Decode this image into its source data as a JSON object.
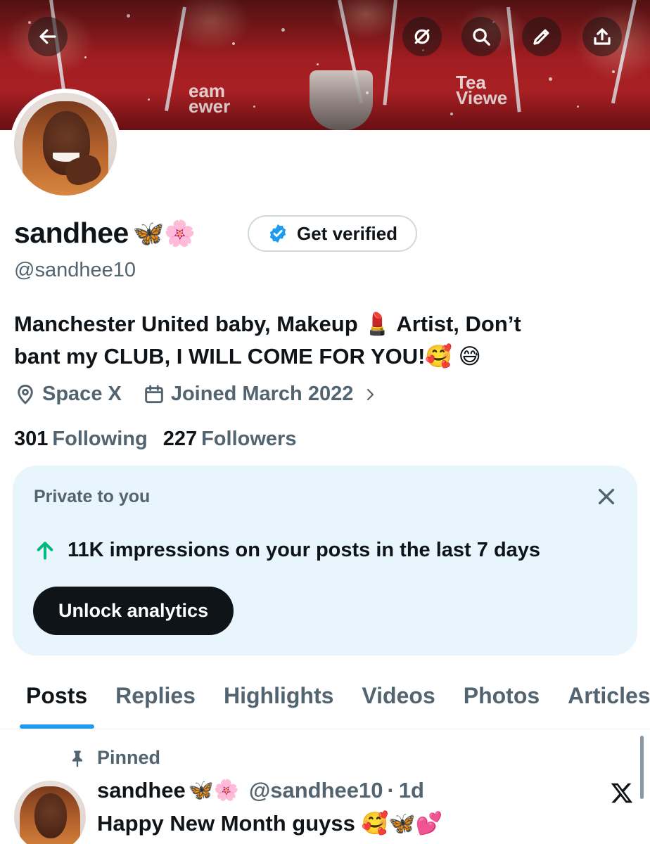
{
  "profile": {
    "display_name": "sandhee",
    "name_emojis": "🦋🌸",
    "handle": "@sandhee10",
    "get_verified_label": "Get verified",
    "bio_line1": "Manchester United baby, Makeup 💄 Artist, Don’t",
    "bio_line2": "bant my CLUB, I WILL COME FOR YOU!🥰 😅",
    "location": "Space X",
    "joined": "Joined March 2022",
    "following_count": "301",
    "following_label": "Following",
    "followers_count": "227",
    "followers_label": "Followers"
  },
  "banner": {
    "sponsor_text_left": "eam\newer",
    "sponsor_text_right": "Tea\nViewe"
  },
  "nav": {
    "back_icon": "arrow-left-icon",
    "buttons": [
      "grok-slash-icon",
      "search-icon",
      "pencil-icon",
      "share-icon"
    ]
  },
  "private_card": {
    "title": "Private to you",
    "stat_text": "11K impressions on your posts in the last 7 days",
    "button_label": "Unlock analytics"
  },
  "tabs": [
    {
      "label": "Posts",
      "active": true
    },
    {
      "label": "Replies",
      "active": false
    },
    {
      "label": "Highlights",
      "active": false
    },
    {
      "label": "Videos",
      "active": false
    },
    {
      "label": "Photos",
      "active": false
    },
    {
      "label": "Articles",
      "active": false
    }
  ],
  "pinned_post": {
    "pinned_label": "Pinned",
    "author": "sandhee",
    "author_emojis": "🦋🌸",
    "handle": "@sandhee10",
    "separator": "·",
    "time": "1d",
    "text": "Happy New Month guyss 🥰🦋💕"
  },
  "colors": {
    "accent": "#1d9bf0",
    "text_primary": "#0f1419",
    "text_secondary": "#536471",
    "card_bg": "#e8f5fd",
    "positive": "#00ba7c"
  }
}
